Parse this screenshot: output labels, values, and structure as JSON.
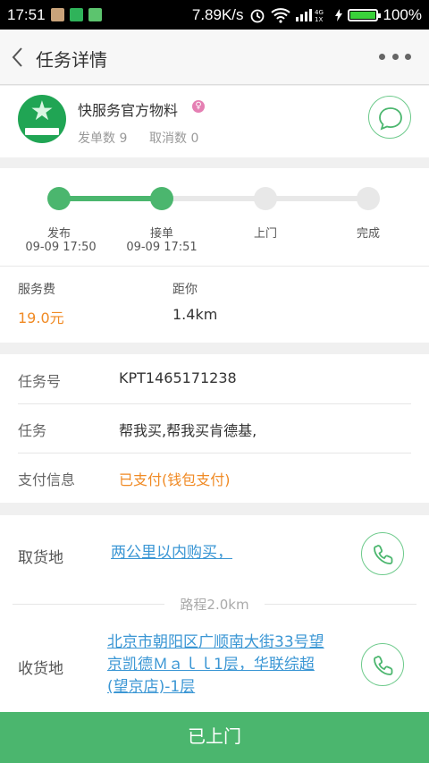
{
  "status_bar": {
    "time": "17:51",
    "net_speed": "7.89K/s",
    "signal": "4G 1X",
    "battery": "100%"
  },
  "header": {
    "title": "任务详情",
    "back_icon": "chevron-left-icon",
    "more_icon": "more-dots-icon"
  },
  "merchant": {
    "name": "快服务官方物料",
    "gender_symbol": "♀",
    "orders_label": "发单数",
    "orders_count": "9",
    "cancel_label": "取消数",
    "cancel_count": "0",
    "avatar_icon": "star-logo-icon",
    "chat_icon": "chat-bubble-icon"
  },
  "progress": {
    "steps": [
      {
        "label": "发布",
        "time": "09-09 17:50",
        "done": true
      },
      {
        "label": "接单",
        "time": "09-09 17:51",
        "done": true
      },
      {
        "label": "上门",
        "time": "",
        "done": false
      },
      {
        "label": "完成",
        "time": "",
        "done": false
      }
    ]
  },
  "fee": {
    "fee_label": "服务费",
    "fee_value": "19.0元",
    "distance_label": "距你",
    "distance_value": "1.4km"
  },
  "info": {
    "task_no_label": "任务号",
    "task_no": "KPT1465171238",
    "task_label": "任务",
    "task_value": "帮我买,帮我买肯德基,",
    "pay_label": "支付信息",
    "pay_value": "已支付(钱包支付)"
  },
  "address": {
    "pickup_label": "取货地",
    "pickup_value": "两公里以内购买，",
    "route_text": "路程2.0km",
    "delivery_label": "收货地",
    "delivery_lines": [
      "北京市朝阳区广顺南大街33号望",
      "京凯德Ｍａｌｌ1层，华联综超",
      "(望京店)-1层"
    ],
    "phone_icon": "phone-icon"
  },
  "action": {
    "label": "已上门"
  },
  "colors": {
    "accent": "#4bb66e",
    "fee": "#f08a24",
    "link": "#3a96d4",
    "inactive_step": "#e8e8e8"
  }
}
